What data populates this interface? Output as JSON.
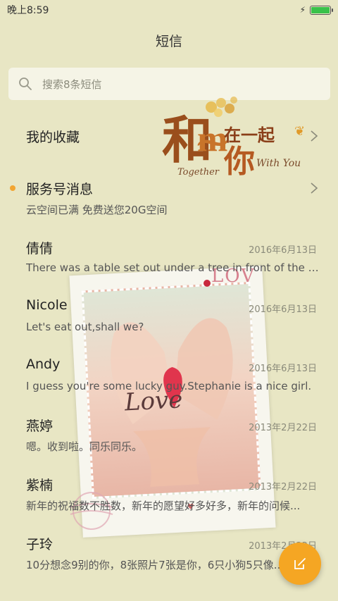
{
  "status": {
    "time": "晚上8:59",
    "battery_level": 1.0,
    "battery_color": "#39c24a"
  },
  "header": {
    "title": "短信"
  },
  "search": {
    "placeholder": "搜索8条短信",
    "icon": "search-icon"
  },
  "decor": {
    "together_cn_big1": "和",
    "together_cn_big2": "你",
    "together_cn_small": "在一起",
    "together_en": "Together",
    "with_you": "With You",
    "photo_love": "Love",
    "love_stack": "LOVE"
  },
  "conversations": [
    {
      "name": "我的收藏",
      "preview": "",
      "date": "",
      "chevron": true,
      "unread": false
    },
    {
      "name": "服务号消息",
      "preview": "云空间已满 免费送您20G空间",
      "date": "",
      "chevron": true,
      "unread": true
    },
    {
      "name": "倩倩",
      "preview": "There was a table set out under a tree in front of the ho...",
      "date": "2016年6月13日",
      "chevron": false,
      "unread": false
    },
    {
      "name": "Nicole",
      "preview": "Let's eat out,shall we?",
      "date": "2016年6月13日",
      "chevron": false,
      "unread": false
    },
    {
      "name": "Andy",
      "preview": "I guess you're some lucky guy.Stephanie is a nice girl.",
      "date": "2016年6月13日",
      "chevron": false,
      "unread": false
    },
    {
      "name": "燕婷",
      "preview": "嗯。收到啦。同乐同乐。",
      "date": "2013年2月22日",
      "chevron": false,
      "unread": false
    },
    {
      "name": "紫楠",
      "preview": "新年的祝福数不胜数，新年的愿望好多好多，新年的问候...",
      "date": "2013年2月22日",
      "chevron": false,
      "unread": false
    },
    {
      "name": "子玲",
      "preview": "10分想念9别的你，8张照片7张是你，6只小狗5只像...",
      "date": "2013年2月22日",
      "chevron": false,
      "unread": false
    }
  ],
  "fab": {
    "icon": "compose-icon",
    "color": "#f5a623"
  }
}
